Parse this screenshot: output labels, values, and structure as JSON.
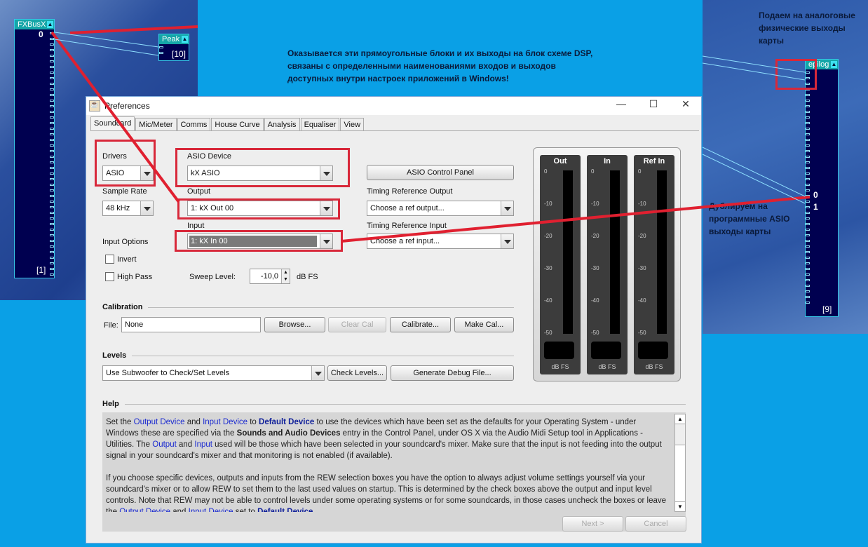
{
  "dsp": {
    "fxbus": {
      "title": "FXBusX",
      "pin0": "0",
      "count": "[1]"
    },
    "peak": {
      "title": "Peak",
      "count": "[10]"
    },
    "epilog": {
      "title": "epilog",
      "pin0": "0",
      "pin1": "1",
      "count": "[9]"
    }
  },
  "notes": {
    "top": "Оказывается эти прямоугольные блоки и их выходы на блок схеме DSP, связаны с определенными наименованиями входов и выходов доступных внутри настроек приложений в Windows!",
    "right_top": "Подаем на аналоговые физические выходы карты",
    "right_mid": "Дублируем на программные ASIO выходы карты"
  },
  "window": {
    "title": "Preferences",
    "minimize": "—",
    "maximize": "☐",
    "close": "✕"
  },
  "tabs": [
    "Soundcard",
    "Mic/Meter",
    "Comms",
    "House Curve",
    "Analysis",
    "Equaliser",
    "View"
  ],
  "soundcard": {
    "drivers_label": "Drivers",
    "drivers_value": "ASIO",
    "asio_device_label": "ASIO Device",
    "asio_device_value": "kX ASIO",
    "asio_control_panel": "ASIO Control Panel",
    "sample_rate_label": "Sample Rate",
    "sample_rate_value": "48 kHz",
    "output_label": "Output",
    "output_value": "1: kX Out 00",
    "timing_out_label": "Timing Reference Output",
    "timing_out_value": "Choose a ref output...",
    "input_label": "Input",
    "input_value": "1: kX In 00",
    "timing_in_label": "Timing Reference Input",
    "timing_in_value": "Choose a ref input...",
    "input_options_label": "Input Options",
    "invert_label": "Invert",
    "high_pass_label": "High Pass",
    "sweep_label": "Sweep Level:",
    "sweep_value": "-10,0",
    "sweep_unit": "dB FS"
  },
  "calibration": {
    "title": "Calibration",
    "file_label": "File:",
    "file_value": "None",
    "browse": "Browse...",
    "clear": "Clear Cal",
    "calibrate": "Calibrate...",
    "make": "Make Cal..."
  },
  "levels": {
    "title": "Levels",
    "mode_value": "Use Subwoofer to Check/Set Levels",
    "check": "Check Levels...",
    "debug": "Generate Debug File..."
  },
  "meters": {
    "names": [
      "Out",
      "In",
      "Ref In"
    ],
    "scale": [
      "0",
      "-10",
      "-20",
      "-30",
      "-40",
      "-50"
    ],
    "unit": "dB FS"
  },
  "help": {
    "title": "Help",
    "p1": [
      [
        "t",
        "Set the "
      ],
      [
        "l",
        "Output Device"
      ],
      [
        "t",
        " and "
      ],
      [
        "l",
        "Input Device"
      ],
      [
        "t",
        " to "
      ],
      [
        "bl",
        "Default Device"
      ],
      [
        "t",
        " to use the devices which have been set as the defaults for your Operating System - under Windows these are specified via the "
      ],
      [
        "b",
        "Sounds and Audio Devices"
      ],
      [
        "t",
        " entry in the Control Panel, under OS X via the Audio Midi Setup tool in Applications - Utilities. The "
      ],
      [
        "l",
        "Output"
      ],
      [
        "t",
        " and "
      ],
      [
        "l",
        "Input"
      ],
      [
        "t",
        " used will be those which have been selected in your soundcard's mixer. Make sure that the input is not feeding into the output signal in your soundcard's mixer and that monitoring is not enabled (if available)."
      ]
    ],
    "p2": [
      [
        "t",
        "If you choose specific devices, outputs and inputs from the REW selection boxes you have the option to always adjust volume settings yourself via your soundcard's mixer or to allow REW to set them to the last used values on startup. This is determined by the check boxes above the output and input level controls. Note that REW may not be able to control levels under some operating systems or for some soundcards, in those cases uncheck the boxes or leave the "
      ],
      [
        "l",
        "Output Device"
      ],
      [
        "t",
        " and "
      ],
      [
        "l",
        "Input Device"
      ],
      [
        "t",
        " set to "
      ],
      [
        "bl",
        "Default Device"
      ],
      [
        "t",
        "."
      ]
    ],
    "next": "Next >",
    "cancel": "Cancel"
  },
  "colors": {
    "annotation": "#d8283a",
    "link": "#1a2ad0",
    "dsp_block": "#000050"
  }
}
